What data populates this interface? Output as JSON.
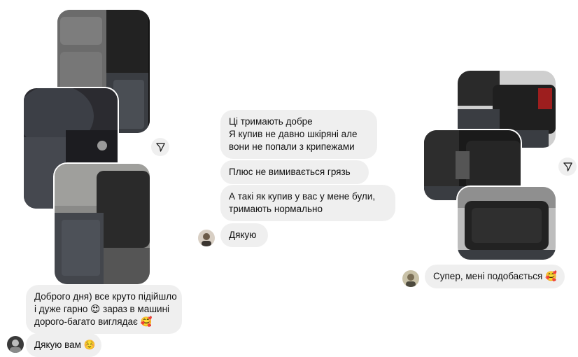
{
  "left_chat": {
    "messages": [
      {
        "lines": [
          "Доброго дня) все круто підійшло",
          "і дуже гарно 😍 зараз в машині",
          "дорого-багато виглядає 🥰"
        ]
      },
      {
        "lines": [
          "Дякую вам ☺️"
        ]
      }
    ],
    "avatar_icon": "user-avatar",
    "share_icon": "send-arrow-icon"
  },
  "middle_chat": {
    "messages": [
      {
        "lines": [
          "Ці тримають добре",
          "Я купив не давно шкіряні але",
          "вони не попали з крипежами"
        ]
      },
      {
        "lines": [
          "Плюс не вимивається грязь"
        ]
      },
      {
        "lines": [
          "А такі як купив у вас у мене були,",
          "тримають нормально"
        ]
      },
      {
        "lines": [
          "Дякую"
        ]
      }
    ],
    "avatar_icon": "user-avatar"
  },
  "right_chat": {
    "messages": [
      {
        "lines": [
          "Супер, мені подобається 🥰"
        ]
      }
    ],
    "avatar_icon": "user-avatar",
    "share_icon": "send-arrow-icon"
  },
  "colors": {
    "bubble": "#efefef",
    "text": "#111111",
    "background": "#ffffff",
    "mat": "#3a3d42",
    "leather": "#2a2a2a"
  }
}
